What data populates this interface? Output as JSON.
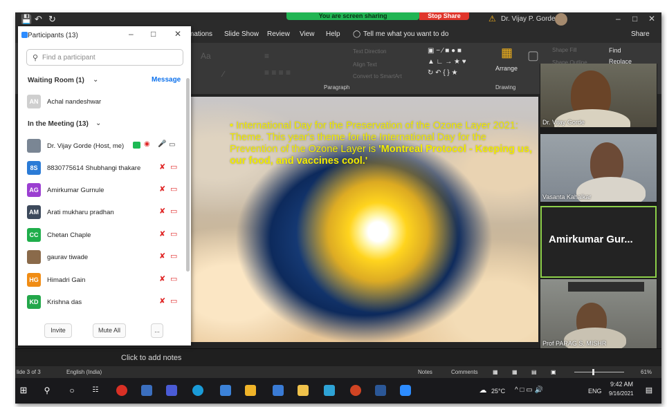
{
  "titlebar": {
    "share_status": "You are screen sharing",
    "stop_share": "Stop Share",
    "user": "Dr. Vijay P. Gorde"
  },
  "tabs": [
    "mations",
    "Slide Show",
    "Review",
    "View",
    "Help"
  ],
  "tell_me": "Tell me what you want to do",
  "share_label": "Share",
  "ribbon": {
    "paragraph": "Paragraph",
    "drawing": "Drawing",
    "arrange": "Arrange",
    "find": "Find",
    "replace": "Replace",
    "text_direction": "Text Direction",
    "align_text": "Align Text",
    "convert": "Convert to SmartArt",
    "shape_fill": "Shape Fill",
    "shape_outline": "Shape Outline"
  },
  "slide": {
    "text_plain": "International Day for the Preservation of the Ozone Layer 2021: Theme. This year's theme for the International Day for the Prevention of the Ozone Layer is ",
    "text_bold": "'Montreal Protocol - Keeping us, our food, and vaccines cool.'"
  },
  "notes_placeholder": "Click to add notes",
  "status": {
    "slide": "lide 3 of 3",
    "language": "English (India)",
    "notes": "Notes",
    "comments": "Comments",
    "zoom": "61%"
  },
  "taskbar": {
    "temperature": "25°C",
    "lang": "ENG",
    "time": "9:42 AM",
    "date": "9/16/2021"
  },
  "video": [
    {
      "name": "Dr. Vijay Gorde"
    },
    {
      "name": "Vasanta Kahalkar"
    },
    {
      "name": "Amirkumar  Gur..."
    },
    {
      "name": "Prof PARAG S. MISHR"
    }
  ],
  "participants": {
    "title": "Participants (13)",
    "search_placeholder": "Find a participant",
    "waiting_room": "Waiting Room (1)",
    "message": "Message",
    "waiting": [
      {
        "initials": "AN",
        "name": "Achal nandeshwar",
        "color": "#c8c8c8"
      }
    ],
    "in_meeting": "In the Meeting (13)",
    "members": [
      {
        "initials": "",
        "name": "Dr. Vijay Gorde (Host, me)",
        "color": "#6b7a8a"
      },
      {
        "initials": "8S",
        "name": "8830775614 Shubhangi thakare",
        "color": "#2b7bd6"
      },
      {
        "initials": "AG",
        "name": "Amirkumar Gurnule",
        "color": "#9b3fd1"
      },
      {
        "initials": "AM",
        "name": "Arati mukharu pradhan",
        "color": "#3d4a5c"
      },
      {
        "initials": "CC",
        "name": "Chetan Chaple",
        "color": "#1fae4b"
      },
      {
        "initials": "",
        "name": "gaurav tiwade",
        "color": "#8a6a4a"
      },
      {
        "initials": "HG",
        "name": "Himadri Gain",
        "color": "#f08c14"
      },
      {
        "initials": "KD",
        "name": "Krishna das",
        "color": "#23a74a"
      }
    ],
    "invite": "Invite",
    "mute_all": "Mute All",
    "more": "..."
  }
}
